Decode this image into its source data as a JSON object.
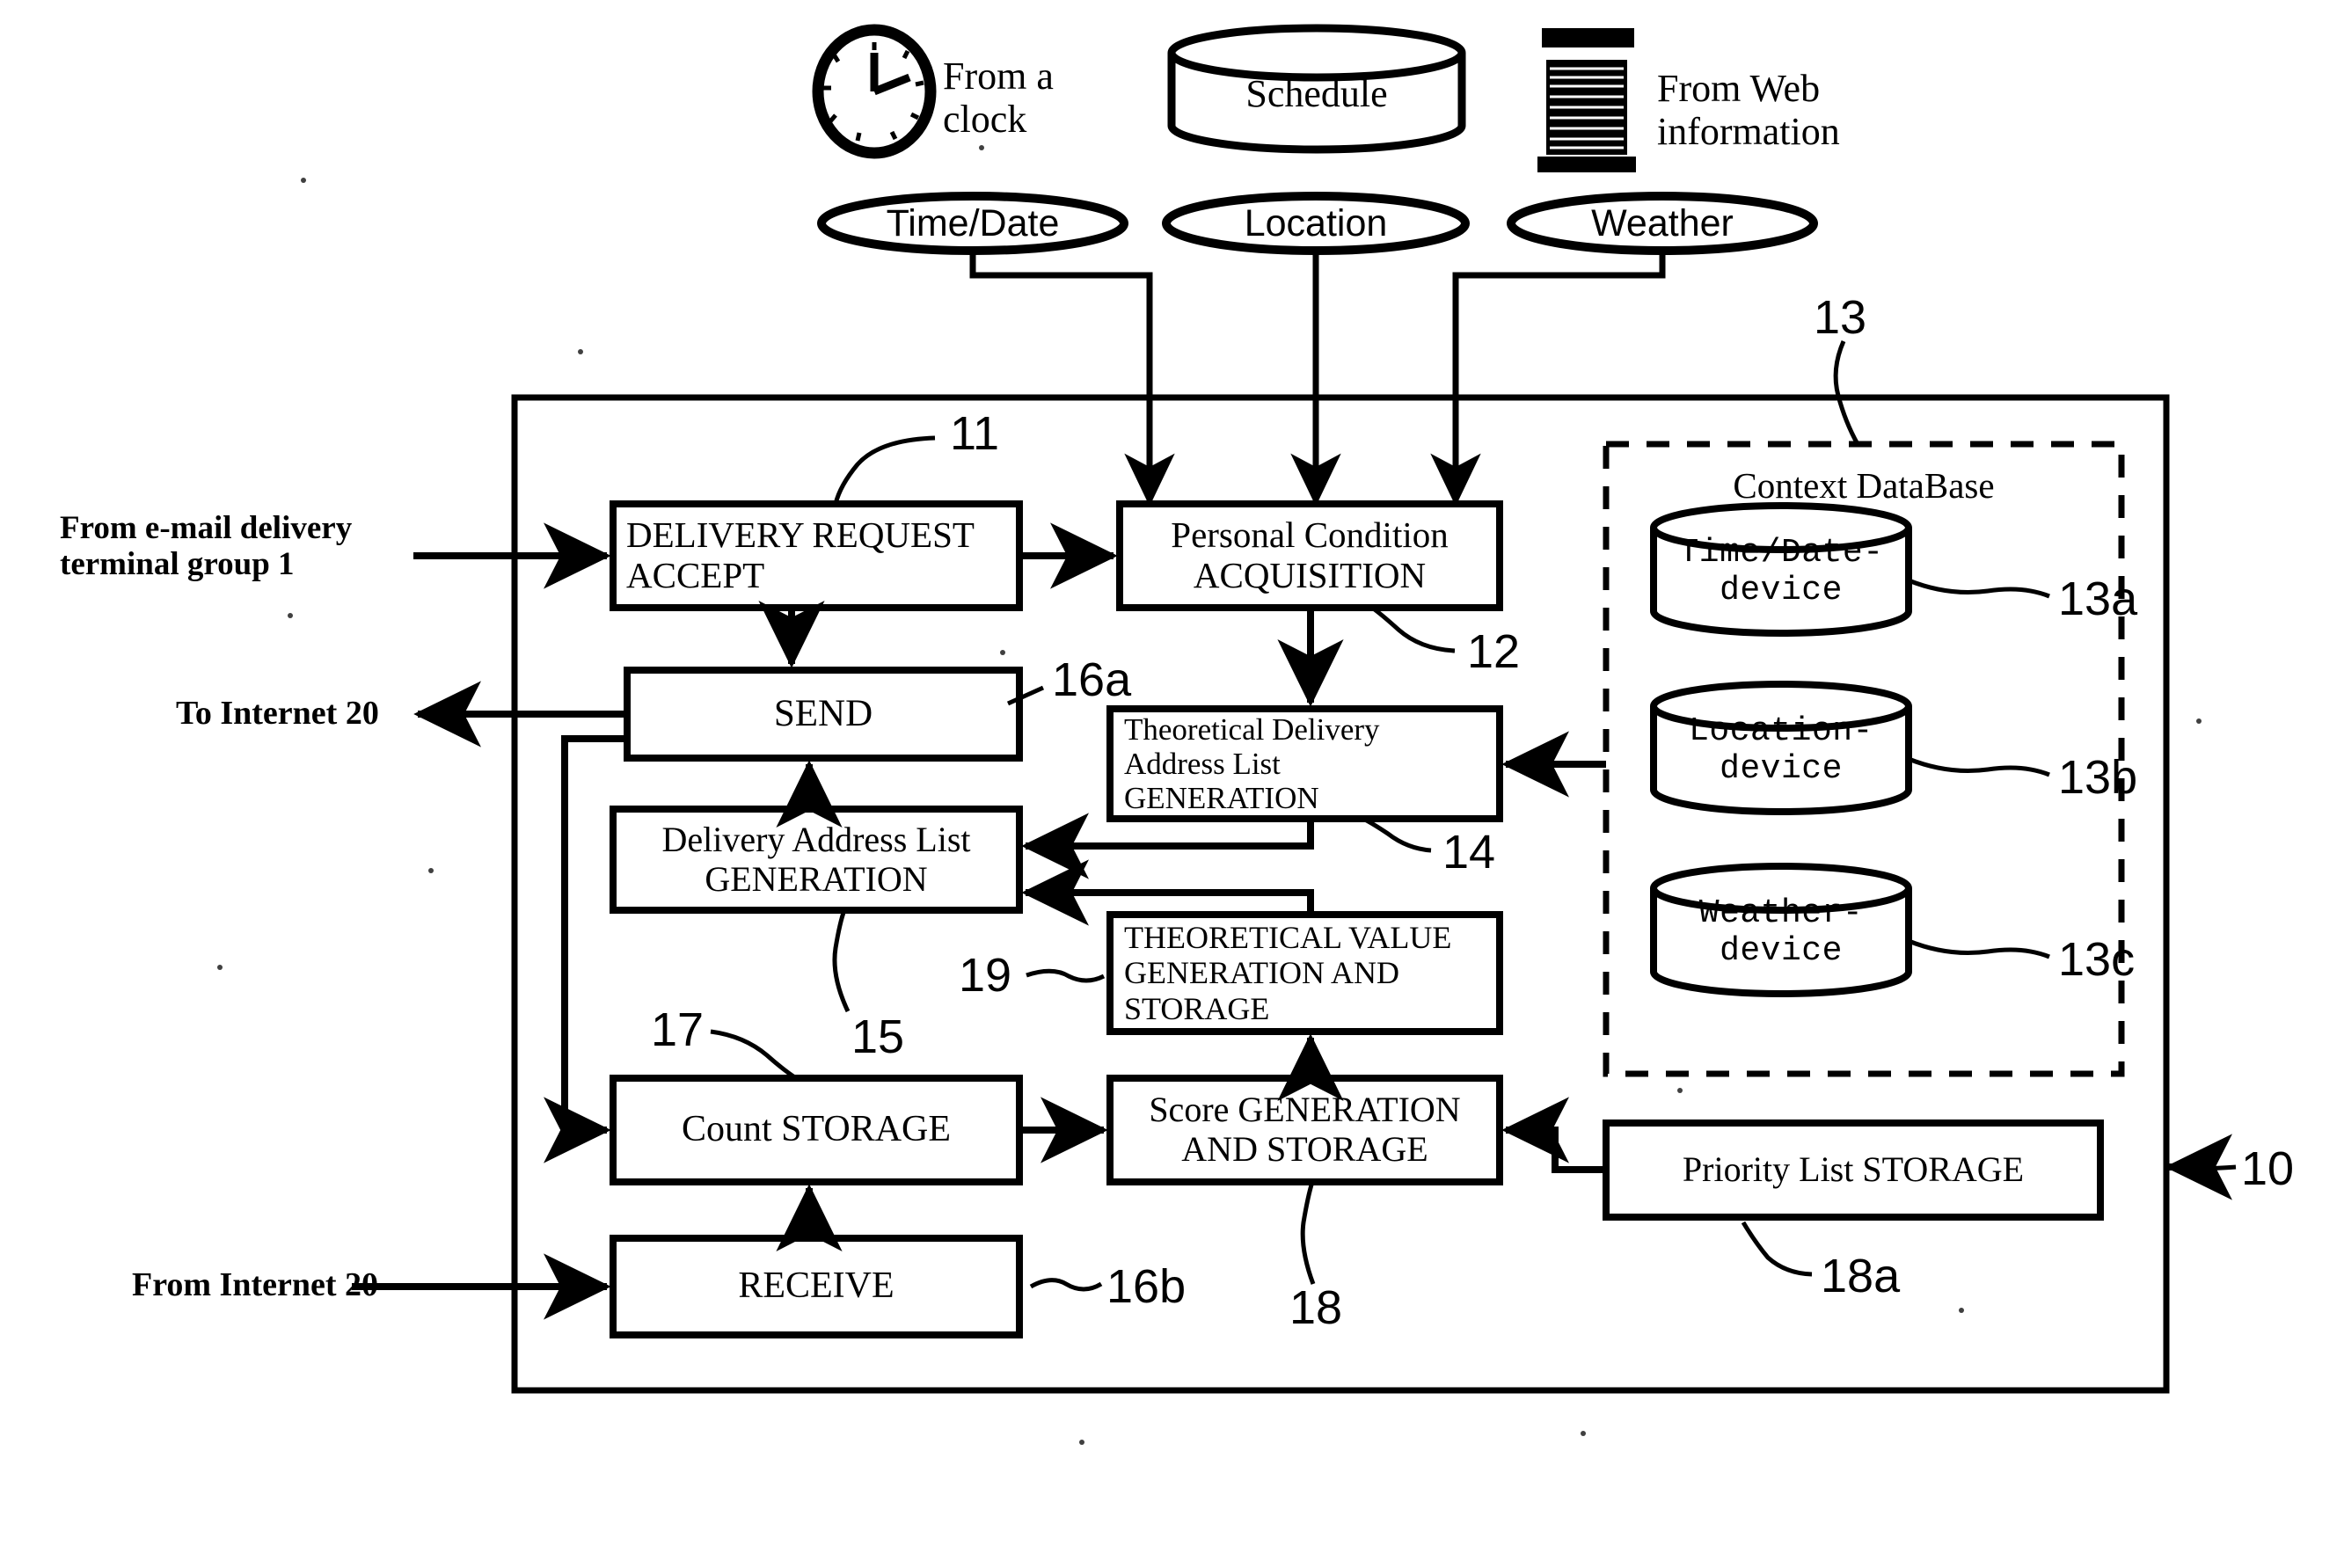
{
  "figure": {
    "type": "patent-block-diagram",
    "sources": [
      {
        "id": "clock",
        "icon": "clock-icon",
        "label": "From a\nclock"
      },
      {
        "id": "schedule",
        "icon": "database-cylinder-icon",
        "label": "Schedule"
      },
      {
        "id": "web",
        "icon": "web-server-icon",
        "label": "From Web\ninformation"
      }
    ],
    "context_ovals": [
      {
        "id": "time-date",
        "label": "Time/Date"
      },
      {
        "id": "location",
        "label": "Location"
      },
      {
        "id": "weather",
        "label": "Weather"
      }
    ],
    "external_labels": [
      {
        "id": "from-email",
        "text": "From e-mail delivery\nterminal group 1"
      },
      {
        "id": "to-internet",
        "text": "To Internet 20"
      },
      {
        "id": "from-internet",
        "text": "From Internet 20"
      }
    ],
    "blocks": [
      {
        "id": "delivery-request-accept",
        "label": "DELIVERY REQUEST\nACCEPT",
        "ref": "11"
      },
      {
        "id": "personal-condition-acquisition",
        "label": "Personal Condition\nACQUISITION",
        "ref": "12"
      },
      {
        "id": "send",
        "label": "SEND",
        "ref": "16a"
      },
      {
        "id": "theoretical-delivery-address-list-generation",
        "label": "Theoretical Delivery\nAddress List\nGENERATION",
        "ref": "14"
      },
      {
        "id": "delivery-address-list-generation",
        "label": "Delivery Address List\nGENERATION",
        "ref": "15"
      },
      {
        "id": "theoretical-value-generation-and-storage",
        "label": "THEORETICAL VALUE\nGENERATION AND\nSTORAGE",
        "ref": "19"
      },
      {
        "id": "count-storage",
        "label": "Count STORAGE",
        "ref": "17"
      },
      {
        "id": "score-generation-and-storage",
        "label": "Score GENERATION\nAND STORAGE",
        "ref": "18"
      },
      {
        "id": "receive",
        "label": "RECEIVE",
        "ref": "16b"
      },
      {
        "id": "priority-list-storage",
        "label": "Priority List STORAGE",
        "ref": "18a"
      }
    ],
    "context_database": {
      "title": "Context DataBase",
      "ref": "13",
      "devices": [
        {
          "id": "time-date-device",
          "label": "Time/Date-device",
          "ref": "13a"
        },
        {
          "id": "location-device",
          "label": "Location-device",
          "ref": "13b"
        },
        {
          "id": "weather-device",
          "label": "Weather-device",
          "ref": "13c"
        }
      ]
    },
    "system_ref": "10",
    "ref_numbers": [
      "11",
      "12",
      "13",
      "13a",
      "13b",
      "13c",
      "14",
      "15",
      "16a",
      "16b",
      "17",
      "18",
      "18a",
      "19",
      "10"
    ],
    "colors": {
      "stroke": "#000000",
      "background": "#ffffff"
    }
  }
}
